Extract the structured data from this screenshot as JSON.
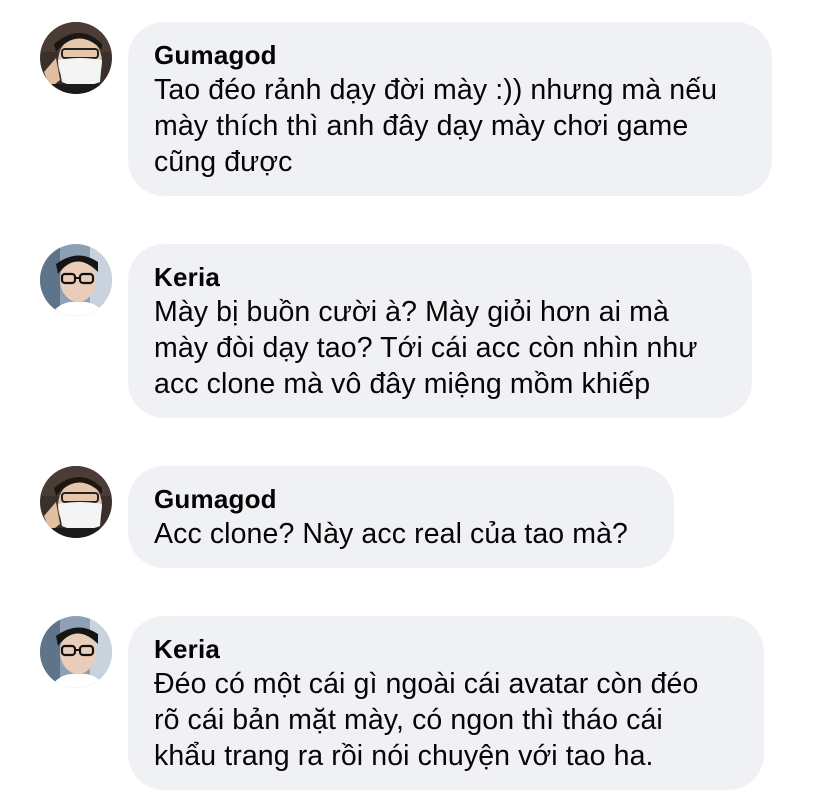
{
  "comments": [
    {
      "author": "Gumagod",
      "avatar_icon": "user-avatar-masked",
      "lines": [
        "Tao đéo rảnh dạy đời mày :)) nhưng mà nếu",
        "mày thích thì anh đây dạy mày chơi game",
        "cũng được"
      ]
    },
    {
      "author": "Keria",
      "avatar_icon": "user-avatar-glasses",
      "lines": [
        "Mày bị buồn cười à? Mày giỏi hơn ai mà",
        "mày đòi dạy tao? Tới cái acc còn nhìn như",
        "acc clone mà vô đây miệng mồm khiếp"
      ]
    },
    {
      "author": "Gumagod",
      "avatar_icon": "user-avatar-masked",
      "lines": [
        "Acc clone? Này acc real của tao mà?"
      ]
    },
    {
      "author": "Keria",
      "avatar_icon": "user-avatar-glasses",
      "lines": [
        "Đéo có một cái gì ngoài cái avatar còn đéo",
        "rõ cái bản mặt mày, có ngon thì tháo cái",
        "khẩu trang ra rồi nói chuyện với tao ha."
      ]
    }
  ],
  "colors": {
    "bubble": "#f0f1f4",
    "text": "#050505"
  }
}
